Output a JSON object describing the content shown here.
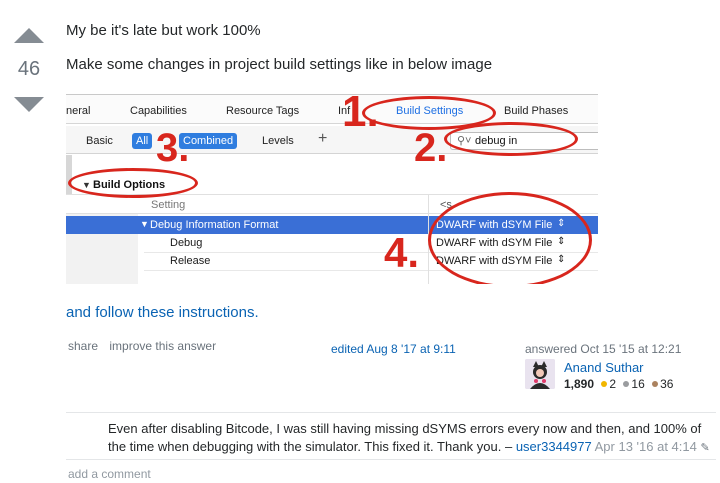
{
  "vote": {
    "count": "46"
  },
  "post": {
    "line1": "My be it's late but work 100%",
    "line2": "Make some changes in project build settings like in below image",
    "follow_link": "and follow these instructions."
  },
  "xcode": {
    "tabs": [
      "neral",
      "Capabilities",
      "Resource Tags",
      "Inf",
      "Build Settings",
      "Build Phases"
    ],
    "filters": {
      "basic": "Basic",
      "all": "All",
      "combined": "Combined",
      "levels": "Levels",
      "plus": "+"
    },
    "search_value": "debug in",
    "section": "Build Options",
    "col_setting": "Setting",
    "col_value": "<s",
    "rows": [
      {
        "label": "Debug Information Format",
        "value": "DWARF with dSYM File"
      },
      {
        "label": "Debug",
        "value": "DWARF with dSYM File"
      },
      {
        "label": "Release",
        "value": "DWARF with dSYM File"
      }
    ],
    "annotations": [
      "1.",
      "2.",
      "3.",
      "4."
    ],
    "annotation_color": "#d8261d"
  },
  "menu": {
    "share": "share",
    "improve": "improve this answer"
  },
  "edited": "edited Aug 8 '17 at 9:11",
  "answered": "answered Oct 15 '15 at 12:21",
  "user": {
    "name": "Anand Suthar",
    "reputation": "1,890",
    "gold": "2",
    "silver": "16",
    "bronze": "36"
  },
  "comment": {
    "text": "Even after disabling Bitcode, I was still having missing dSYMS errors every now and then, and 100% of the time when debugging with the simulator. This fixed it. Thank you. –",
    "user": "user3344977",
    "date": "Apr 13 '16 at 4:14"
  },
  "add_comment": "add a comment"
}
